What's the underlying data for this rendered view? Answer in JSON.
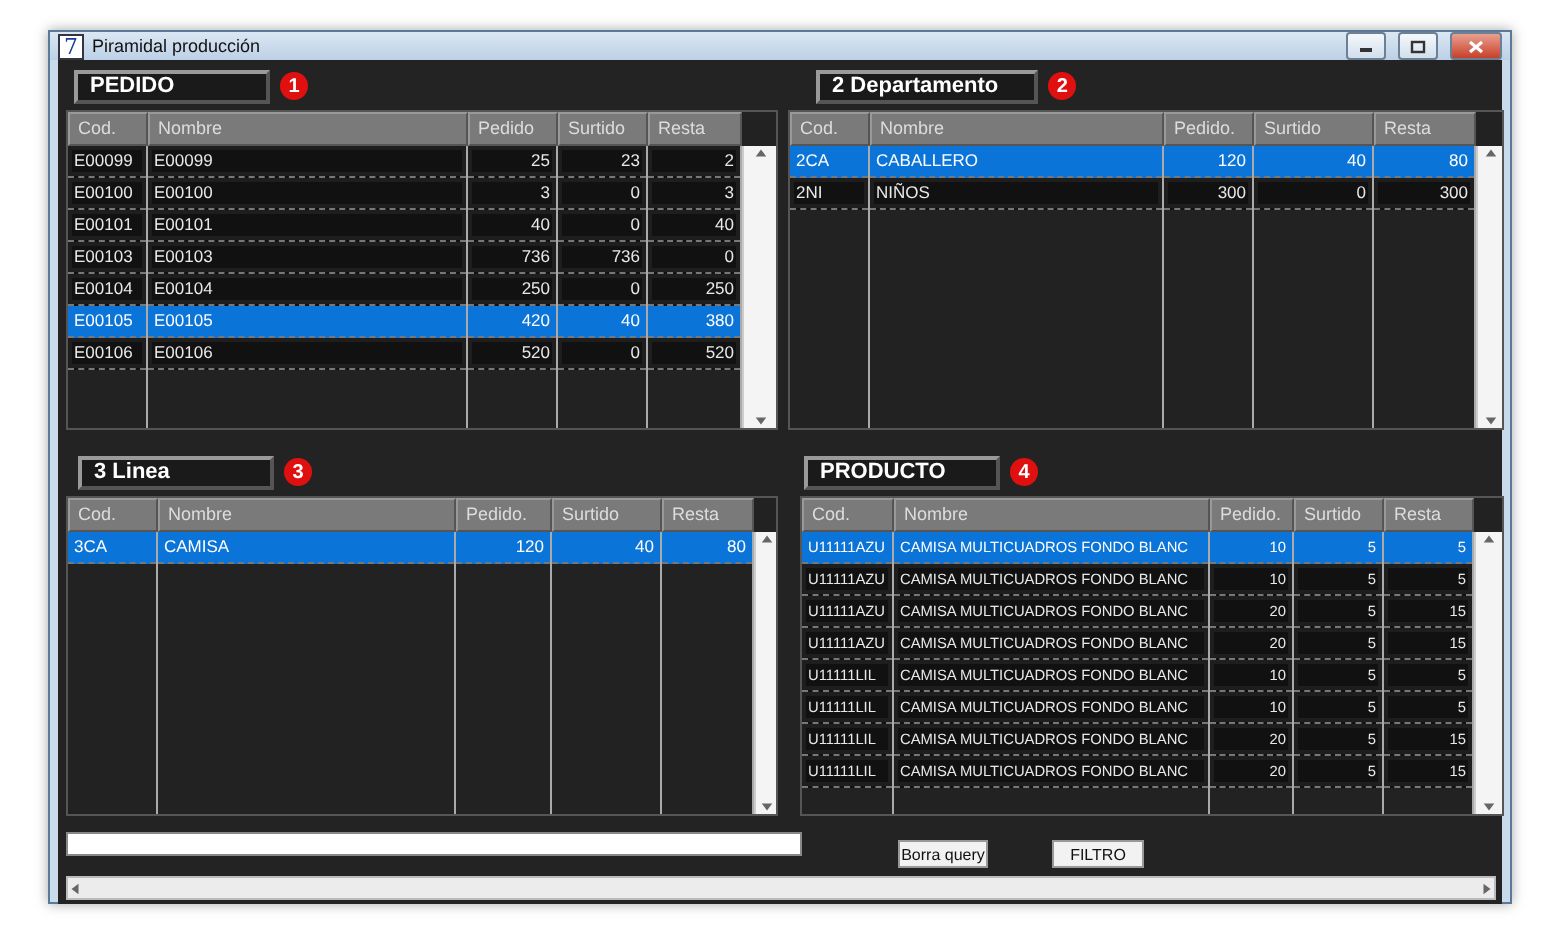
{
  "window": {
    "title": "Piramidal producción",
    "icon": "7"
  },
  "panels": [
    {
      "title": "PEDIDO",
      "badge": "1",
      "columns": [
        "Cod.",
        "Nombre",
        "Pedido",
        "Surtido",
        "Resta"
      ],
      "rows": [
        {
          "cells": [
            "E00099",
            "E00099",
            "25",
            "23",
            "2"
          ],
          "selected": false
        },
        {
          "cells": [
            "E00100",
            "E00100",
            "3",
            "0",
            "3"
          ],
          "selected": false
        },
        {
          "cells": [
            "E00101",
            "E00101",
            "40",
            "0",
            "40"
          ],
          "selected": false
        },
        {
          "cells": [
            "E00103",
            "E00103",
            "736",
            "736",
            "0"
          ],
          "selected": false
        },
        {
          "cells": [
            "E00104",
            "E00104",
            "250",
            "0",
            "250"
          ],
          "selected": false
        },
        {
          "cells": [
            "E00105",
            "E00105",
            "420",
            "40",
            "380"
          ],
          "selected": true
        },
        {
          "cells": [
            "E00106",
            "E00106",
            "520",
            "0",
            "520"
          ],
          "selected": false
        }
      ]
    },
    {
      "title": "2 Departamento",
      "badge": "2",
      "columns": [
        "Cod.",
        "Nombre",
        "Pedido.",
        "Surtido",
        "Resta"
      ],
      "rows": [
        {
          "cells": [
            "2CA",
            "CABALLERO",
            "120",
            "40",
            "80"
          ],
          "selected": true
        },
        {
          "cells": [
            "2NI",
            "NIÑOS",
            "300",
            "0",
            "300"
          ],
          "selected": false
        }
      ]
    },
    {
      "title": "3 Linea",
      "badge": "3",
      "columns": [
        "Cod.",
        "Nombre",
        "Pedido.",
        "Surtido",
        "Resta"
      ],
      "rows": [
        {
          "cells": [
            "3CA",
            "CAMISA",
            "120",
            "40",
            "80"
          ],
          "selected": true
        }
      ]
    },
    {
      "title": "PRODUCTO",
      "badge": "4",
      "columns": [
        "Cod.",
        "Nombre",
        "Pedido.",
        "Surtido",
        "Resta"
      ],
      "rows": [
        {
          "cells": [
            "U11111AZU",
            "CAMISA MULTICUADROS FONDO BLANC",
            "10",
            "5",
            "5"
          ],
          "selected": true
        },
        {
          "cells": [
            "U11111AZU",
            "CAMISA MULTICUADROS FONDO BLANC",
            "10",
            "5",
            "5"
          ],
          "selected": false
        },
        {
          "cells": [
            "U11111AZU",
            "CAMISA MULTICUADROS FONDO BLANC",
            "20",
            "5",
            "15"
          ],
          "selected": false
        },
        {
          "cells": [
            "U11111AZU",
            "CAMISA MULTICUADROS FONDO BLANC",
            "20",
            "5",
            "15"
          ],
          "selected": false
        },
        {
          "cells": [
            "U11111LIL",
            "CAMISA MULTICUADROS FONDO BLANC",
            "10",
            "5",
            "5"
          ],
          "selected": false
        },
        {
          "cells": [
            "U11111LIL",
            "CAMISA MULTICUADROS FONDO BLANC",
            "10",
            "5",
            "5"
          ],
          "selected": false
        },
        {
          "cells": [
            "U11111LIL",
            "CAMISA MULTICUADROS FONDO BLANC",
            "20",
            "5",
            "15"
          ],
          "selected": false
        },
        {
          "cells": [
            "U11111LIL",
            "CAMISA MULTICUADROS FONDO BLANC",
            "20",
            "5",
            "15"
          ],
          "selected": false
        }
      ]
    }
  ],
  "buttons": [
    "Borra query",
    "FILTRO"
  ]
}
